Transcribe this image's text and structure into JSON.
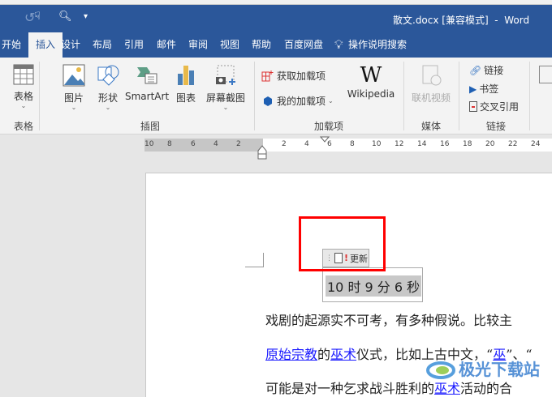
{
  "window": {
    "title": "散文.docx [兼容模式]  -  Word"
  },
  "qat": {
    "redo_icon": "redo-icon",
    "touch_icon": "touch-mode-icon",
    "preview_icon": "print-preview-icon",
    "customize_icon": "customize-qat-icon"
  },
  "tabs": [
    {
      "label": "开始"
    },
    {
      "label": "插入",
      "active": true
    },
    {
      "label": "设计"
    },
    {
      "label": "布局"
    },
    {
      "label": "引用"
    },
    {
      "label": "邮件"
    },
    {
      "label": "审阅"
    },
    {
      "label": "视图"
    },
    {
      "label": "帮助"
    },
    {
      "label": "百度网盘"
    },
    {
      "label": "操作说明搜索"
    }
  ],
  "ribbon": {
    "groups": [
      {
        "label": "表格"
      },
      {
        "label": "插图"
      },
      {
        "label": "加载项"
      },
      {
        "label": "媒体"
      },
      {
        "label": "链接"
      }
    ],
    "table": "表格",
    "picture": "图片",
    "shapes": "形状",
    "smartart": "SmartArt",
    "chart": "图表",
    "screenshot": "屏幕截图",
    "get_addins": "获取加载项",
    "my_addins": "我的加载项",
    "wikipedia": "Wikipedia",
    "wiki_glyph": "W",
    "online_video": "联机视频",
    "link": "链接",
    "bookmark": "书签",
    "cross_ref": "交叉引用"
  },
  "ruler": {
    "left": [
      "10",
      "8",
      "6",
      "4",
      "2"
    ],
    "right": [
      "2",
      "4",
      "6",
      "8",
      "10",
      "12",
      "14",
      "16",
      "18",
      "20",
      "22",
      "24"
    ]
  },
  "document": {
    "update_button": "更新",
    "field_text": "10 时 9 分 6 秒",
    "line1": "戏剧的起源实不可考，有多种假说。比较主",
    "line2": [
      {
        "t": "原始宗教",
        "link": true
      },
      {
        "t": "的"
      },
      {
        "t": "巫术",
        "link": true
      },
      {
        "t": "仪式，比如上古中文，“"
      },
      {
        "t": "巫",
        "link": true
      },
      {
        "t": "”、“"
      }
    ],
    "line3": [
      {
        "t": "可能是对一种乞求战斗胜利的"
      },
      {
        "t": "巫术",
        "link": true
      },
      {
        "t": "活动的合"
      }
    ]
  },
  "watermark": "极光下载站",
  "colors": {
    "brand": "#2b579a",
    "highlight": "#ff0000",
    "link": "#1a1aff"
  }
}
